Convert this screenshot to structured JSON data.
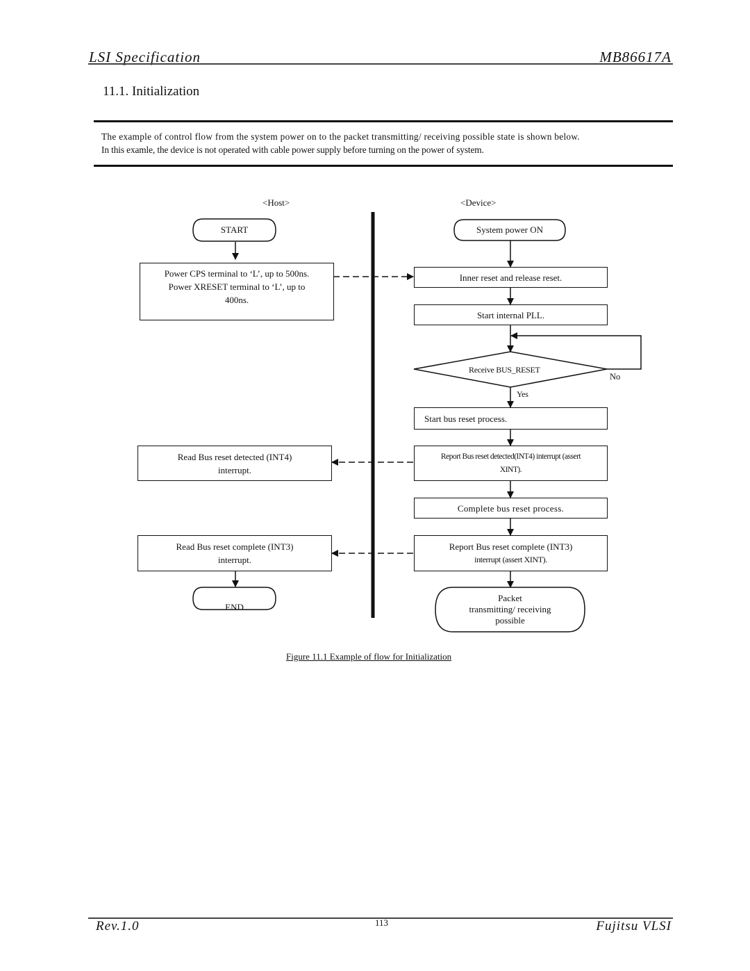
{
  "header": {
    "left": "LSI Specification",
    "right": "MB86617A"
  },
  "section": {
    "title": "11.1. Initialization"
  },
  "intro": {
    "line1": "The example of control flow from the system power on to the packet transmitting/ receiving possible state is shown below.",
    "line2": "In this examle, the device is not operated with cable power supply before turning on the power of system."
  },
  "diagram": {
    "lanes": {
      "host": "<Host>",
      "device": "<Device>"
    },
    "host": {
      "start": "START",
      "power_step": [
        "Power CPS terminal to ‘L’, up to 500ns.",
        "Power XRESET terminal to ‘L’, up to",
        "400ns."
      ],
      "read_int4": [
        "Read Bus reset detected (INT4)",
        "interrupt."
      ],
      "read_int3": [
        "Read Bus reset complete (INT3)",
        "interrupt."
      ],
      "end": "END"
    },
    "device": {
      "power_on": "System power ON",
      "inner_reset": "Inner reset and release reset.",
      "start_pll": "Start internal PLL.",
      "decision": "Receive BUS_RESET",
      "decision_no": "No",
      "decision_yes": "Yes",
      "start_bus_reset": "Start bus reset process.",
      "report_int4": [
        "Report Bus reset detected(INT4) interrupt (assert",
        "XINT)."
      ],
      "complete_bus_reset": "Complete bus reset process.",
      "report_int3": [
        "Report Bus reset complete (INT3)",
        "interrupt (assert XINT)."
      ],
      "final": [
        "Packet",
        "transmitting/ receiving",
        "possible"
      ]
    },
    "caption": "Figure 11.1 Example of flow for Initialization"
  },
  "footer": {
    "left": "Rev.1.0",
    "page": "113",
    "right": "Fujitsu VLSI"
  }
}
